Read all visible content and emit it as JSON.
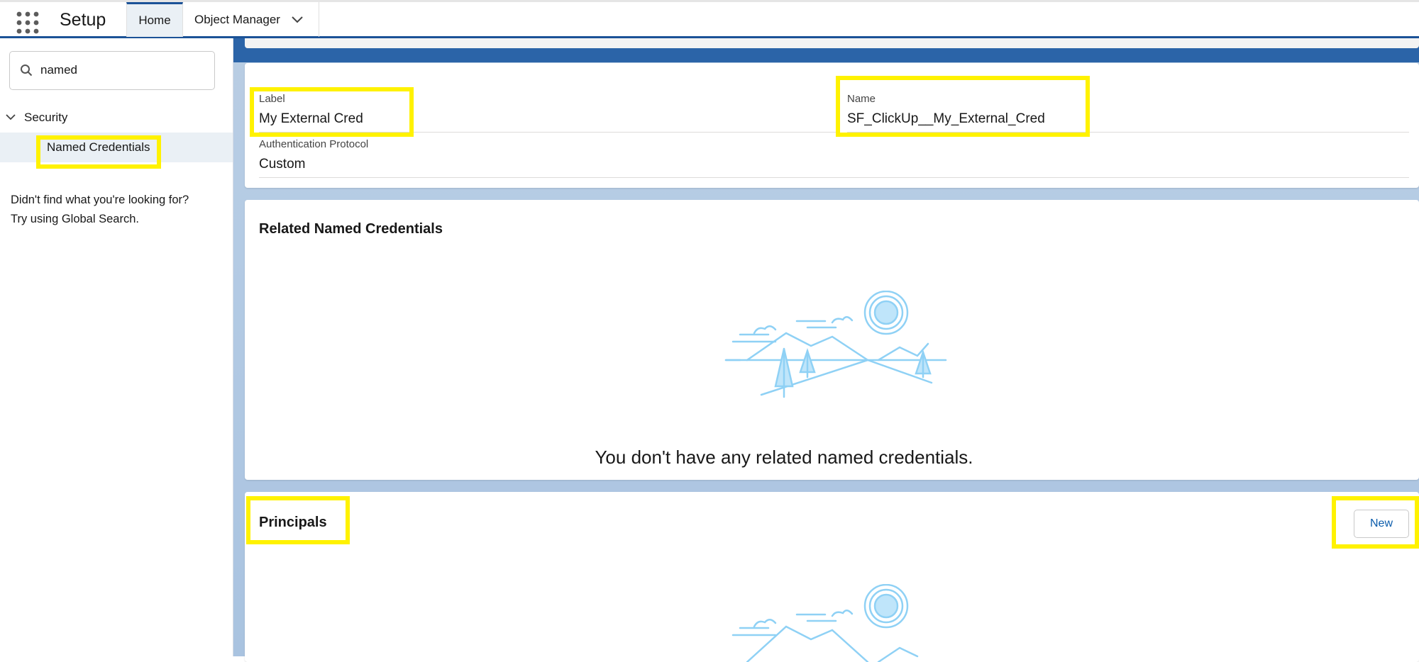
{
  "header": {
    "app_title": "Setup",
    "tabs": [
      {
        "label": "Home"
      },
      {
        "label": "Object Manager"
      }
    ]
  },
  "sidebar": {
    "search": {
      "value": "named"
    },
    "tree": {
      "group_label": "Security",
      "item_label": "Named Credentials"
    },
    "not_found_line1": "Didn't find what you're looking for?",
    "not_found_line2": "Try using Global Search."
  },
  "details": {
    "label_caption": "Label",
    "label_value": "My External Cred",
    "name_caption": "Name",
    "name_value": "SF_ClickUp__My_External_Cred",
    "auth_caption": "Authentication Protocol",
    "auth_value": "Custom"
  },
  "related": {
    "title": "Related Named Credentials",
    "empty_message": "You don't have any related named credentials."
  },
  "principals": {
    "title": "Principals",
    "new_label": "New"
  },
  "colors": {
    "brand_blue": "#1b5297",
    "highlight": "#fff200",
    "illustration": "#8fd1f5",
    "link_blue": "#0b5cab"
  },
  "icons": [
    "app-launcher-icon",
    "chevron-down-icon",
    "search-icon",
    "empty-state-illustration"
  ]
}
